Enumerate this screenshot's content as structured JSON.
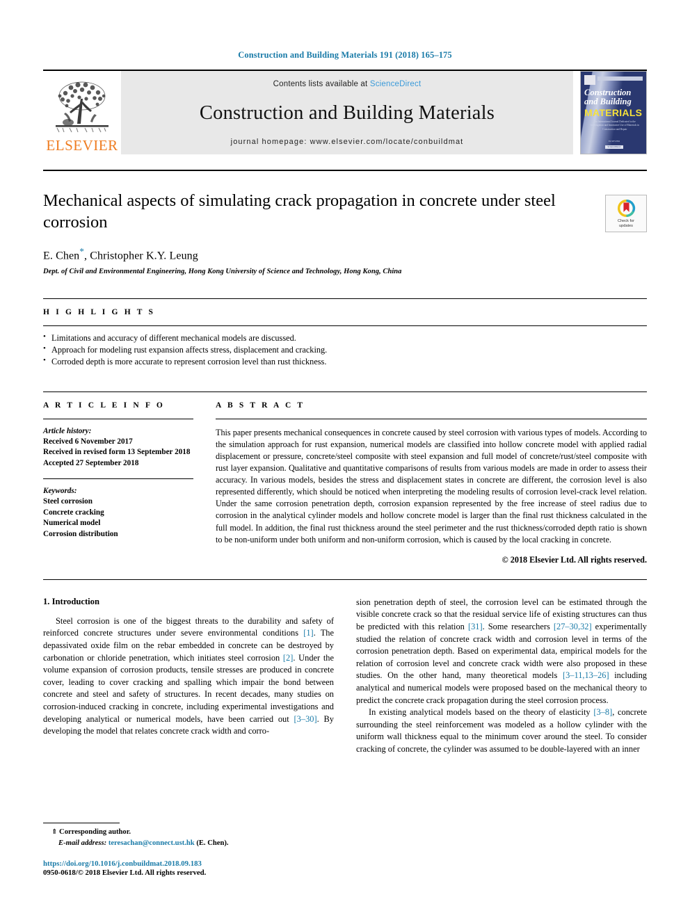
{
  "running_head": "Construction and Building Materials 191 (2018) 165–175",
  "masthead": {
    "publisher_name": "ELSEVIER",
    "contents_prefix": "Contents lists available at ",
    "contents_link": "ScienceDirect",
    "journal_name": "Construction and Building Materials",
    "homepage": "journal homepage: www.elsevier.com/locate/conbuildmat",
    "cover": {
      "line1": "Construction",
      "line2": "and Building",
      "line3": "MATERIALS",
      "blurb": "An International Journal Dedicated to the Investigation and Innovative Use of Materials in Construction and Repair",
      "footer": "ELSEVIER",
      "badge": "ScienceDirect"
    }
  },
  "article": {
    "title": "Mechanical aspects of simulating crack propagation in concrete under steel corrosion",
    "authors_pre": "E. Chen",
    "authors_star": "*",
    "authors_post": ", Christopher K.Y. Leung",
    "affiliation": "Dept. of Civil and Environmental Engineering, Hong Kong University of Science and Technology, Hong Kong, China",
    "crossmark_label_line1": "Check for",
    "crossmark_label_line2": "updates"
  },
  "highlights": {
    "heading": "H I G H L I G H T S",
    "items": [
      "Limitations and accuracy of different mechanical models are discussed.",
      "Approach for modeling rust expansion affects stress, displacement and cracking.",
      "Corroded depth is more accurate to represent corrosion level than rust thickness."
    ]
  },
  "article_info": {
    "heading": "A R T I C L E    I N F O",
    "history_label": "Article history:",
    "history": [
      "Received 6 November 2017",
      "Received in revised form 13 September 2018",
      "Accepted 27 September 2018"
    ],
    "keywords_label": "Keywords:",
    "keywords": [
      "Steel corrosion",
      "Concrete cracking",
      "Numerical model",
      "Corrosion distribution"
    ]
  },
  "abstract": {
    "heading": "A B S T R A C T",
    "text": "This paper presents mechanical consequences in concrete caused by steel corrosion with various types of models. According to the simulation approach for rust expansion, numerical models are classified into hollow concrete model with applied radial displacement or pressure, concrete/steel composite with steel expansion and full model of concrete/rust/steel composite with rust layer expansion. Qualitative and quantitative comparisons of results from various models are made in order to assess their accuracy. In various models, besides the stress and displacement states in concrete are different, the corrosion level is also represented differently, which should be noticed when interpreting the modeling results of corrosion level-crack level relation. Under the same corrosion penetration depth, corrosion expansion represented by the free increase of steel radius due to corrosion in the analytical cylinder models and hollow concrete model is larger than the final rust thickness calculated in the full model. In addition, the final rust thickness around the steel perimeter and the rust thickness/corroded depth ratio is shown to be non-uniform under both uniform and non-uniform corrosion, which is caused by the local cracking in concrete.",
    "copyright": "© 2018 Elsevier Ltd. All rights reserved."
  },
  "body": {
    "section_heading": "1. Introduction",
    "left_para_1": {
      "seg1": "Steel corrosion is one of the biggest threats to the durability and safety of reinforced concrete structures under severe environmental conditions ",
      "cite1": "[1]",
      "seg2": ". The depassivated oxide film on the rebar embedded in concrete can be destroyed by carbonation or chloride penetration, which initiates steel corrosion ",
      "cite2": "[2]",
      "seg3": ". Under the volume expansion of corrosion products, tensile stresses are produced in concrete cover, leading to cover cracking and spalling which impair the bond between concrete and steel and safety of structures. In recent decades, many studies on corrosion-induced cracking in concrete, including experimental investigations and developing analytical or numerical models, have been carried out ",
      "cite3": "[3–30]",
      "seg4": ". By developing the model that relates concrete crack width and corro-"
    },
    "right_para_1": {
      "seg1": "sion penetration depth of steel, the corrosion level can be estimated through the visible concrete crack so that the residual service life of existing structures can thus be predicted with this relation ",
      "cite1": "[31]",
      "seg2": ". Some researchers ",
      "cite2": "[27–30,32]",
      "seg3": " experimentally studied the relation of concrete crack width and corrosion level in terms of the corrosion penetration depth. Based on experimental data, empirical models for the relation of corrosion level and concrete crack width were also proposed in these studies. On the other hand, many theoretical models ",
      "cite3": "[3–11,13–26]",
      "seg4": " including analytical and numerical models were proposed based on the mechanical theory to predict the concrete crack propagation during the steel corrosion process."
    },
    "right_para_2": {
      "seg1": "In existing analytical models based on the theory of elasticity ",
      "cite1": "[3–8]",
      "seg2": ", concrete surrounding the steel reinforcement was modeled as a hollow cylinder with the uniform wall thickness equal to the minimum cover around the steel. To consider cracking of concrete, the cylinder was assumed to be double-layered with an inner"
    }
  },
  "footnote": {
    "corresponding": "Corresponding author.",
    "email_label": "E-mail address:",
    "email": "teresachan@connect.ust.hk",
    "email_owner": "(E. Chen).",
    "doi": "https://doi.org/10.1016/j.conbuildmat.2018.09.183",
    "issn": "0950-0618/© 2018 Elsevier Ltd. All rights reserved."
  },
  "colors": {
    "link_blue": "#1a7ba8",
    "sciencedirect_blue": "#3a9ad9",
    "elsevier_orange": "#ef7d22",
    "cover_navy": "#2a3870",
    "cover_yellow": "#f5e03a"
  }
}
